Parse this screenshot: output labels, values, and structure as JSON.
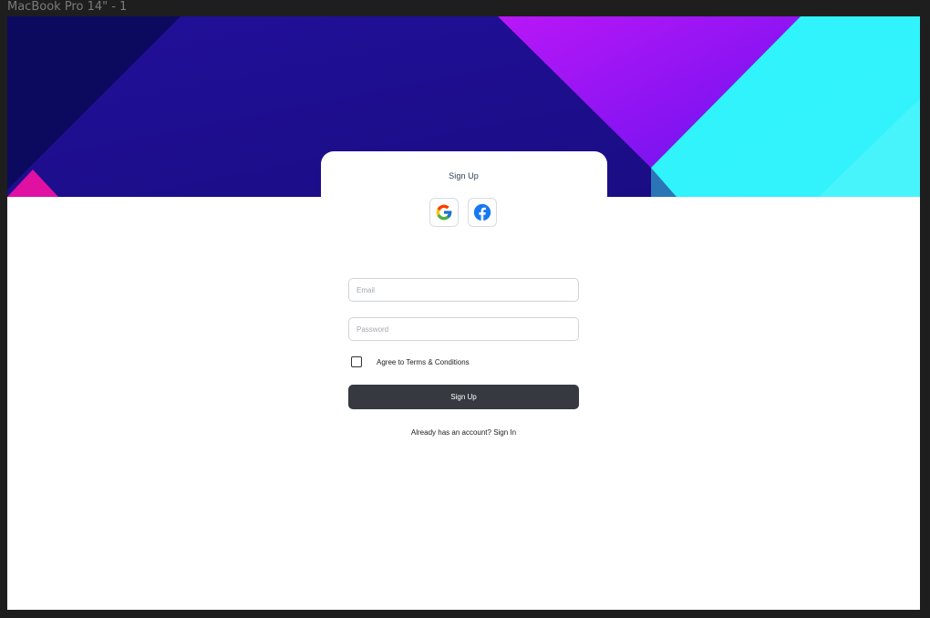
{
  "frame": {
    "label": "MacBook Pro 14\" - 1"
  },
  "hero": {
    "colors": {
      "dark_navy": "#0d0a5c",
      "indigo": "#1f0f8f",
      "violet": "#a516f5",
      "cyan": "#2ef4fb",
      "magenta": "#e0109f"
    }
  },
  "card": {
    "title": "Sign Up"
  },
  "social": {
    "google_icon": "google-icon",
    "facebook_icon": "facebook-icon"
  },
  "form": {
    "email_placeholder": "Email",
    "password_placeholder": "Password",
    "terms_label": "Agree to Terms & Conditions",
    "submit_label": "Sign Up",
    "signin_prompt": "Already has an account? ",
    "signin_link": "Sign In"
  },
  "colors": {
    "button_bg": "#363a40",
    "facebook_blue": "#1877f2"
  }
}
